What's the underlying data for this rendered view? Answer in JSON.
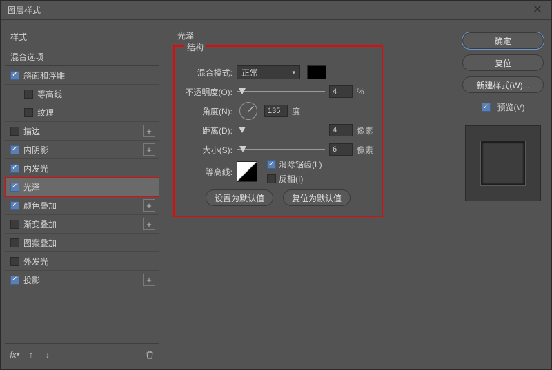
{
  "title": "图层样式",
  "sidebar": {
    "styles_header": "样式",
    "blend_options": "混合选项",
    "items": [
      {
        "label": "斜面和浮雕",
        "checked": true,
        "add": false
      },
      {
        "label": "等高线",
        "checked": false,
        "add": false,
        "child": true
      },
      {
        "label": "纹理",
        "checked": false,
        "add": false,
        "child": true
      },
      {
        "label": "描边",
        "checked": false,
        "add": true
      },
      {
        "label": "内阴影",
        "checked": true,
        "add": true
      },
      {
        "label": "内发光",
        "checked": true,
        "add": false
      },
      {
        "label": "光泽",
        "checked": true,
        "add": false,
        "selected": true
      },
      {
        "label": "颜色叠加",
        "checked": true,
        "add": true
      },
      {
        "label": "渐变叠加",
        "checked": false,
        "add": true
      },
      {
        "label": "图案叠加",
        "checked": false,
        "add": false
      },
      {
        "label": "外发光",
        "checked": false,
        "add": false
      },
      {
        "label": "投影",
        "checked": true,
        "add": true
      }
    ]
  },
  "panel": {
    "title": "光泽",
    "structure": "结构",
    "blend_mode": {
      "label": "混合模式:",
      "value": "正常"
    },
    "opacity": {
      "label": "不透明度(O):",
      "value": "4",
      "unit": "%",
      "pos": 4
    },
    "angle": {
      "label": "角度(N):",
      "value": "135",
      "unit": "度"
    },
    "distance": {
      "label": "距离(D):",
      "value": "4",
      "unit": "像素",
      "pos": 4
    },
    "size": {
      "label": "大小(S):",
      "value": "6",
      "unit": "像素",
      "pos": 6
    },
    "contour": {
      "label": "等高线:"
    },
    "antialias": {
      "label": "消除锯齿(L)",
      "checked": true
    },
    "invert": {
      "label": "反相(I)",
      "checked": false
    },
    "set_default": "设置为默认值",
    "reset_default": "复位为默认值"
  },
  "right": {
    "ok": "确定",
    "reset": "复位",
    "new_style": "新建样式(W)...",
    "preview": "预览(V)"
  },
  "chart_data": {
    "type": "table",
    "title": "光泽 (Satin) layer style parameters",
    "rows": [
      {
        "param": "混合模式",
        "value": "正常"
      },
      {
        "param": "不透明度",
        "value": 4,
        "unit": "%"
      },
      {
        "param": "角度",
        "value": 135,
        "unit": "度"
      },
      {
        "param": "距离",
        "value": 4,
        "unit": "像素"
      },
      {
        "param": "大小",
        "value": 6,
        "unit": "像素"
      },
      {
        "param": "消除锯齿",
        "value": true
      },
      {
        "param": "反相",
        "value": false
      }
    ]
  }
}
